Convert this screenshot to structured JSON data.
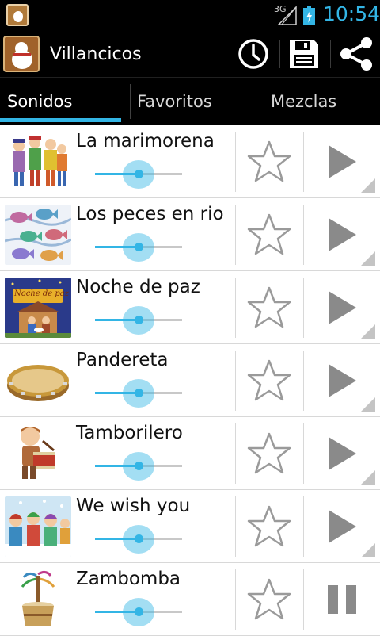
{
  "status_bar": {
    "network": "3G",
    "time": "10:54"
  },
  "action_bar": {
    "title": "Villancicos",
    "actions": [
      {
        "icon": "history-clock-icon"
      },
      {
        "icon": "save-floppy-icon"
      },
      {
        "icon": "share-icon"
      }
    ]
  },
  "tabs": [
    {
      "label": "Sonidos",
      "active": true
    },
    {
      "label": "Favoritos",
      "active": false
    },
    {
      "label": "Mezclas",
      "active": false
    }
  ],
  "sounds": [
    {
      "title": "La marimorena",
      "volume": 0.5,
      "favorite": false,
      "state": "play"
    },
    {
      "title": "Los peces en rio",
      "volume": 0.5,
      "favorite": false,
      "state": "play"
    },
    {
      "title": "Noche de paz",
      "volume": 0.5,
      "favorite": false,
      "state": "play"
    },
    {
      "title": "Pandereta",
      "volume": 0.5,
      "favorite": false,
      "state": "play"
    },
    {
      "title": "Tamborilero",
      "volume": 0.5,
      "favorite": false,
      "state": "play"
    },
    {
      "title": "We wish you",
      "volume": 0.5,
      "favorite": false,
      "state": "play"
    },
    {
      "title": "Zambomba",
      "volume": 0.5,
      "favorite": false,
      "state": "pause"
    }
  ],
  "thumbnail_text": {
    "noche_de_paz": "Noche de paz"
  },
  "colors": {
    "accent": "#33b5e5",
    "bar_background": "#000000",
    "icon_gray": "#8a8a8a"
  }
}
